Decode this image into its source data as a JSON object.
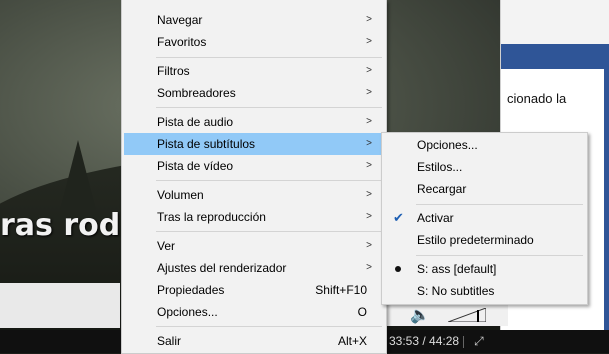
{
  "background": {
    "subtitle_text": "ras rodea",
    "side_text": "cionado la",
    "time_display": "33:53 / 44:28"
  },
  "main_menu": {
    "items": [
      {
        "label": "Navegar",
        "submenu": true
      },
      {
        "label": "Favoritos",
        "submenu": true
      },
      {
        "label": "Filtros",
        "submenu": true
      },
      {
        "label": "Sombreadores",
        "submenu": true
      },
      {
        "label": "Pista de audio",
        "submenu": true
      },
      {
        "label": "Pista de subtítulos",
        "submenu": true,
        "highlighted": true
      },
      {
        "label": "Pista de vídeo",
        "submenu": true
      },
      {
        "label": "Volumen",
        "submenu": true
      },
      {
        "label": "Tras la reproducción",
        "submenu": true
      },
      {
        "label": "Ver",
        "submenu": true
      },
      {
        "label": "Ajustes del renderizador",
        "submenu": true
      },
      {
        "label": "Propiedades",
        "shortcut": "Shift+F10"
      },
      {
        "label": "Opciones...",
        "shortcut": "O"
      },
      {
        "label": "Salir",
        "shortcut": "Alt+X"
      }
    ]
  },
  "sub_menu": {
    "items": [
      {
        "label": "Opciones..."
      },
      {
        "label": "Estilos..."
      },
      {
        "label": "Recargar"
      },
      {
        "label": "Activar",
        "checked": true
      },
      {
        "label": "Estilo predeterminado"
      },
      {
        "label": "S: ass [default]",
        "selected": true
      },
      {
        "label": "S: No subtitles"
      }
    ]
  },
  "colors": {
    "menu_bg": "#f2f2f2",
    "highlight": "#91c9f7",
    "check": "#1e5fb3"
  },
  "icons": [
    "chevron-right-icon",
    "checkmark-icon",
    "radio-dot-icon",
    "speaker-icon",
    "fullscreen-icon"
  ]
}
